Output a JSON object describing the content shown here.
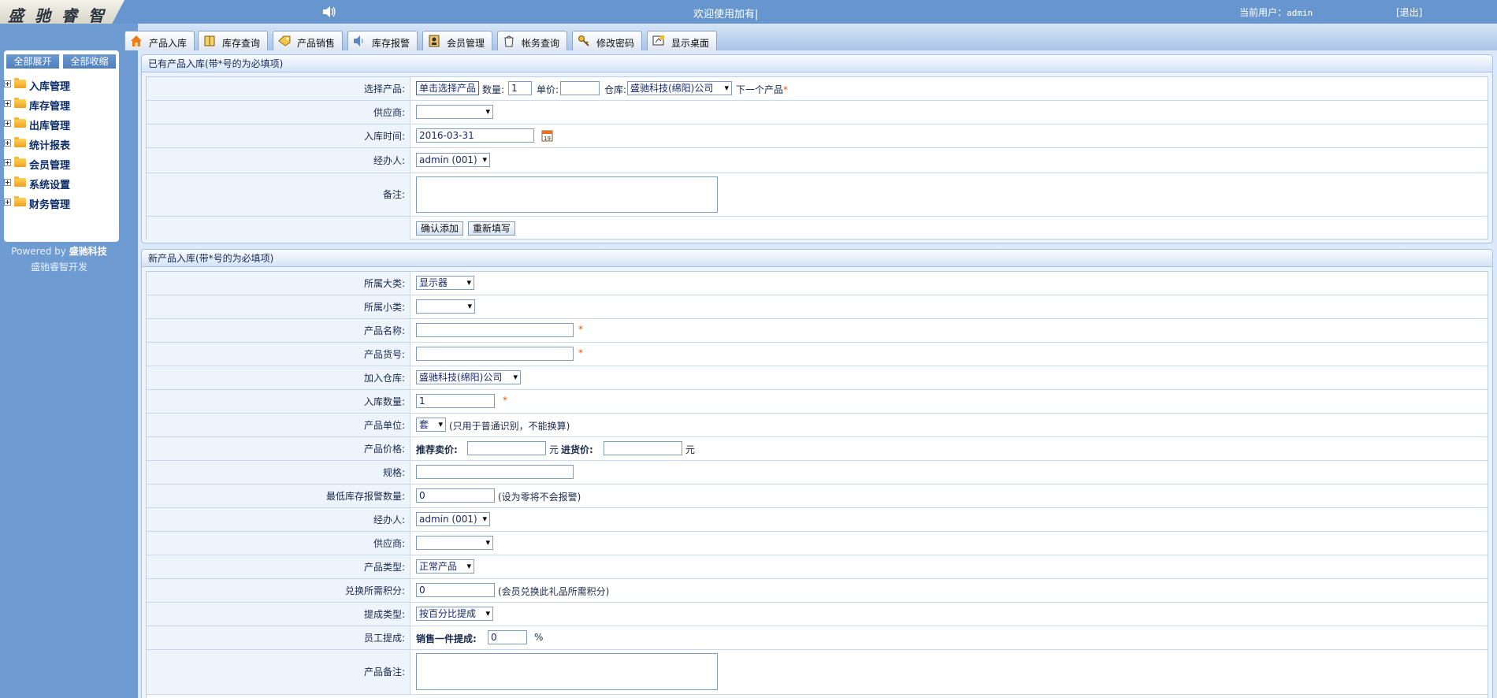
{
  "app": {
    "logo_text": "盛驰睿智",
    "welcome": "欢迎使用加有|",
    "current_user_label": "当前用户：",
    "current_user": "admin",
    "logout": "[退出]"
  },
  "sidebar": {
    "expand_all": "全部展开",
    "collapse_all": "全部收缩",
    "items": [
      {
        "label": "入库管理"
      },
      {
        "label": "库存管理"
      },
      {
        "label": "出库管理"
      },
      {
        "label": "统计报表"
      },
      {
        "label": "会员管理"
      },
      {
        "label": "系统设置"
      },
      {
        "label": "财务管理"
      }
    ],
    "powered_prefix": "Powered by",
    "powered_company": "盛驰科技",
    "developer": "盛驰睿智开发"
  },
  "tabs": [
    {
      "label": "产品入库",
      "icon": "house-icon"
    },
    {
      "label": "库存查询",
      "icon": "book-icon"
    },
    {
      "label": "产品销售",
      "icon": "tag-icon"
    },
    {
      "label": "库存报警",
      "icon": "speaker-icon"
    },
    {
      "label": "会员管理",
      "icon": "member-icon"
    },
    {
      "label": "帐务查询",
      "icon": "bucket-icon"
    },
    {
      "label": "修改密码",
      "icon": "key-icon"
    },
    {
      "label": "显示桌面",
      "icon": "desktop-icon"
    }
  ],
  "existing_form": {
    "title": "已有产品入库(带*号的为必填项)",
    "product_label": "选择产品:",
    "select_product_btn": "单击选择产品",
    "quantity_label": "数量:",
    "quantity_value": "1",
    "unit_price_label": "单价:",
    "unit_price_value": "",
    "warehouse_label": "仓库:",
    "warehouse_value": "盛驰科技(绵阳)公司",
    "next_product": "下一个产品",
    "star": "*",
    "supplier_label": "供应商:",
    "supplier_value": "",
    "date_label": "入库时间:",
    "date_value": "2016-03-31",
    "operator_label": "经办人:",
    "operator_value": "admin (001)",
    "remark_label": "备注:",
    "confirm_btn": "确认添加",
    "reset_btn": "重新填写"
  },
  "new_form": {
    "title": "新产品入库(带*号的为必填项)",
    "category_label": "所属大类:",
    "category_value": "显示器",
    "subcategory_label": "所属小类:",
    "subcategory_value": "",
    "name_label": "产品名称:",
    "name_value": "",
    "code_label": "产品货号:",
    "code_value": "",
    "warehouse_label": "加入仓库:",
    "warehouse_value": "盛驰科技(绵阳)公司",
    "qty_label": "入库数量:",
    "qty_value": "1",
    "unit_label": "产品单位:",
    "unit_value": "套",
    "unit_note": "(只用于普通识别，不能换算)",
    "price_label": "产品价格:",
    "sale_price_label": "推荐卖价:",
    "sale_price_value": "",
    "yuan": "元",
    "cost_price_label": "进货价:",
    "cost_price_value": "",
    "spec_label": "规格:",
    "spec_value": "",
    "min_stock_label": "最低库存报警数量:",
    "min_stock_value": "0",
    "min_stock_note": "(设为零将不会报警)",
    "operator_label": "经办人:",
    "operator_value": "admin (001)",
    "supplier_label": "供应商:",
    "supplier_value": "",
    "type_label": "产品类型:",
    "type_value": "正常产品",
    "points_label": "兑换所需积分:",
    "points_value": "0",
    "points_note": "(会员兑换此礼品所需积分)",
    "commission_type_label": "提成类型:",
    "commission_type_value": "按百分比提成",
    "staff_commission_label": "员工提成:",
    "per_item_label": "销售一件提成:",
    "per_item_value": "0",
    "percent": "%",
    "remark_label": "产品备注:",
    "star": "*"
  }
}
